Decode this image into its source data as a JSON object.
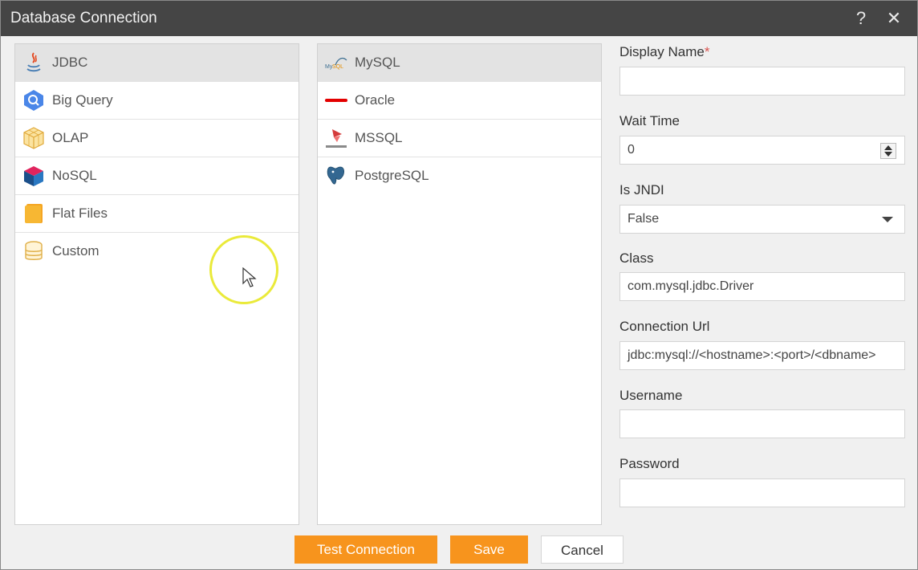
{
  "window": {
    "title": "Database Connection",
    "help_glyph": "?",
    "close_glyph": "✕"
  },
  "categories": [
    {
      "label": "JDBC",
      "icon": "java-icon",
      "selected": true
    },
    {
      "label": "Big Query",
      "icon": "bigquery-icon",
      "selected": false
    },
    {
      "label": "OLAP",
      "icon": "olap-cube-icon",
      "selected": false
    },
    {
      "label": "NoSQL",
      "icon": "nosql-cube-icon",
      "selected": false
    },
    {
      "label": "Flat Files",
      "icon": "file-icon",
      "selected": false
    },
    {
      "label": "Custom",
      "icon": "database-icon",
      "selected": false
    }
  ],
  "drivers": [
    {
      "label": "MySQL",
      "icon": "mysql-icon",
      "selected": true
    },
    {
      "label": "Oracle",
      "icon": "oracle-icon",
      "selected": false
    },
    {
      "label": "MSSQL",
      "icon": "sqlserver-icon",
      "selected": false
    },
    {
      "label": "PostgreSQL",
      "icon": "postgresql-icon",
      "selected": false
    }
  ],
  "form": {
    "display_name": {
      "label": "Display Name",
      "required_mark": "*",
      "value": ""
    },
    "wait_time": {
      "label": "Wait Time",
      "value": "0"
    },
    "is_jndi": {
      "label": "Is JNDI",
      "value": "False"
    },
    "class": {
      "label": "Class",
      "value": "com.mysql.jdbc.Driver"
    },
    "connection_url": {
      "label": "Connection Url",
      "value": "jdbc:mysql://<hostname>:<port>/<dbname>"
    },
    "username": {
      "label": "Username",
      "value": ""
    },
    "password": {
      "label": "Password",
      "value": ""
    }
  },
  "buttons": {
    "test_connection": "Test Connection",
    "save": "Save",
    "cancel": "Cancel"
  },
  "colors": {
    "titlebar": "#454545",
    "accent": "#f7941d",
    "selected_row": "#e3e3e3",
    "required": "#d9534f"
  }
}
